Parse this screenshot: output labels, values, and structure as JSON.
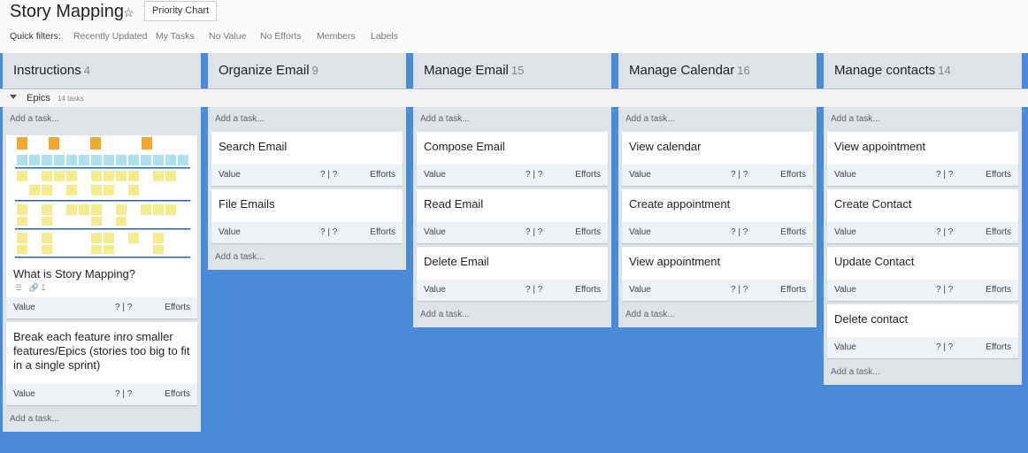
{
  "header": {
    "title": "Story Mapping",
    "star_icon": "star-icon",
    "priority_button": "Priority Chart",
    "quick_filters_label": "Quick filters:",
    "filters": [
      "Recently Updated",
      "My Tasks",
      "No Value",
      "No Efforts",
      "Members",
      "Labels"
    ]
  },
  "swimlane": {
    "label": "Epics",
    "count": "14 tasks"
  },
  "add_task": "Add a task...",
  "meta": {
    "value": "Value",
    "score": "? | ?",
    "efforts": "Efforts"
  },
  "columns": [
    {
      "name": "Instructions",
      "count": "4",
      "cards": [
        {
          "title": "What is Story Mapping?",
          "has_image": true,
          "attachments": "1"
        },
        {
          "title": "Break each feature inro smaller features/Epics (stories too big to fit in a single sprint)"
        }
      ]
    },
    {
      "name": "Organize Email",
      "count": "9",
      "cards": [
        {
          "title": "Search Email"
        },
        {
          "title": "File Emails"
        }
      ]
    },
    {
      "name": "Manage Email",
      "count": "15",
      "cards": [
        {
          "title": "Compose Email"
        },
        {
          "title": "Read Email"
        },
        {
          "title": "Delete Email"
        }
      ]
    },
    {
      "name": "Manage Calendar",
      "count": "16",
      "cards": [
        {
          "title": "View calendar"
        },
        {
          "title": "Create appointment"
        },
        {
          "title": "View appointment"
        }
      ]
    },
    {
      "name": "Manage contacts",
      "count": "14",
      "cards": [
        {
          "title": "View appointment"
        },
        {
          "title": "Create Contact"
        },
        {
          "title": "Update Contact"
        },
        {
          "title": "Delete contact"
        }
      ]
    }
  ],
  "colors": {
    "board_bg": "#4a8bd9",
    "column_bg": "#dfe3e6",
    "card_meta_bg": "#eef1f3"
  }
}
